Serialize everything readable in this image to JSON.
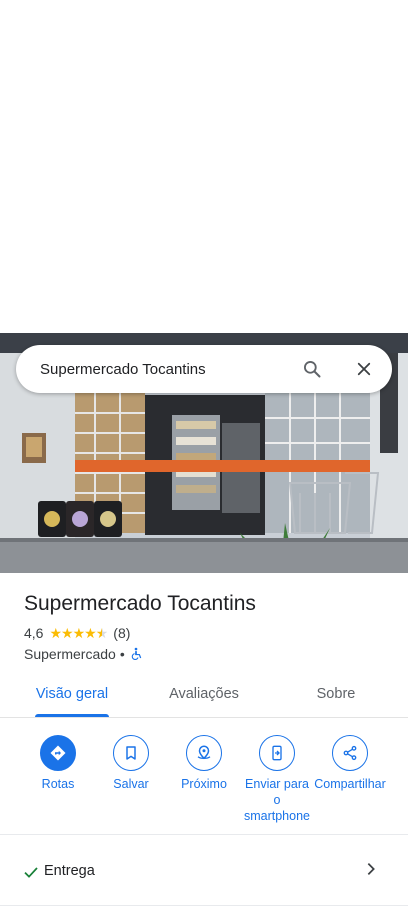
{
  "search": {
    "query": "Supermercado Tocantins"
  },
  "place": {
    "name": "Supermercado Tocantins",
    "rating": "4,6",
    "stars": 4.6,
    "reviews": "(8)",
    "category": "Supermercado",
    "separator": "•",
    "accessibility_icon": "wheelchair-icon"
  },
  "tabs": [
    {
      "label": "Visão geral",
      "active": true
    },
    {
      "label": "Avaliações",
      "active": false
    },
    {
      "label": "Sobre",
      "active": false
    }
  ],
  "actions": [
    {
      "label": "Rotas",
      "icon": "directions-icon"
    },
    {
      "label": "Salvar",
      "icon": "bookmark-icon"
    },
    {
      "label": "Próximo",
      "icon": "nearby-icon"
    },
    {
      "label": "Enviar para o smartphone",
      "icon": "send-to-phone-icon"
    },
    {
      "label": "Compartilhar",
      "icon": "share-icon"
    }
  ],
  "services": {
    "delivery_label": "Entrega"
  },
  "colors": {
    "accent": "#1a73e8",
    "star": "#fbbc04",
    "check": "#188038"
  }
}
